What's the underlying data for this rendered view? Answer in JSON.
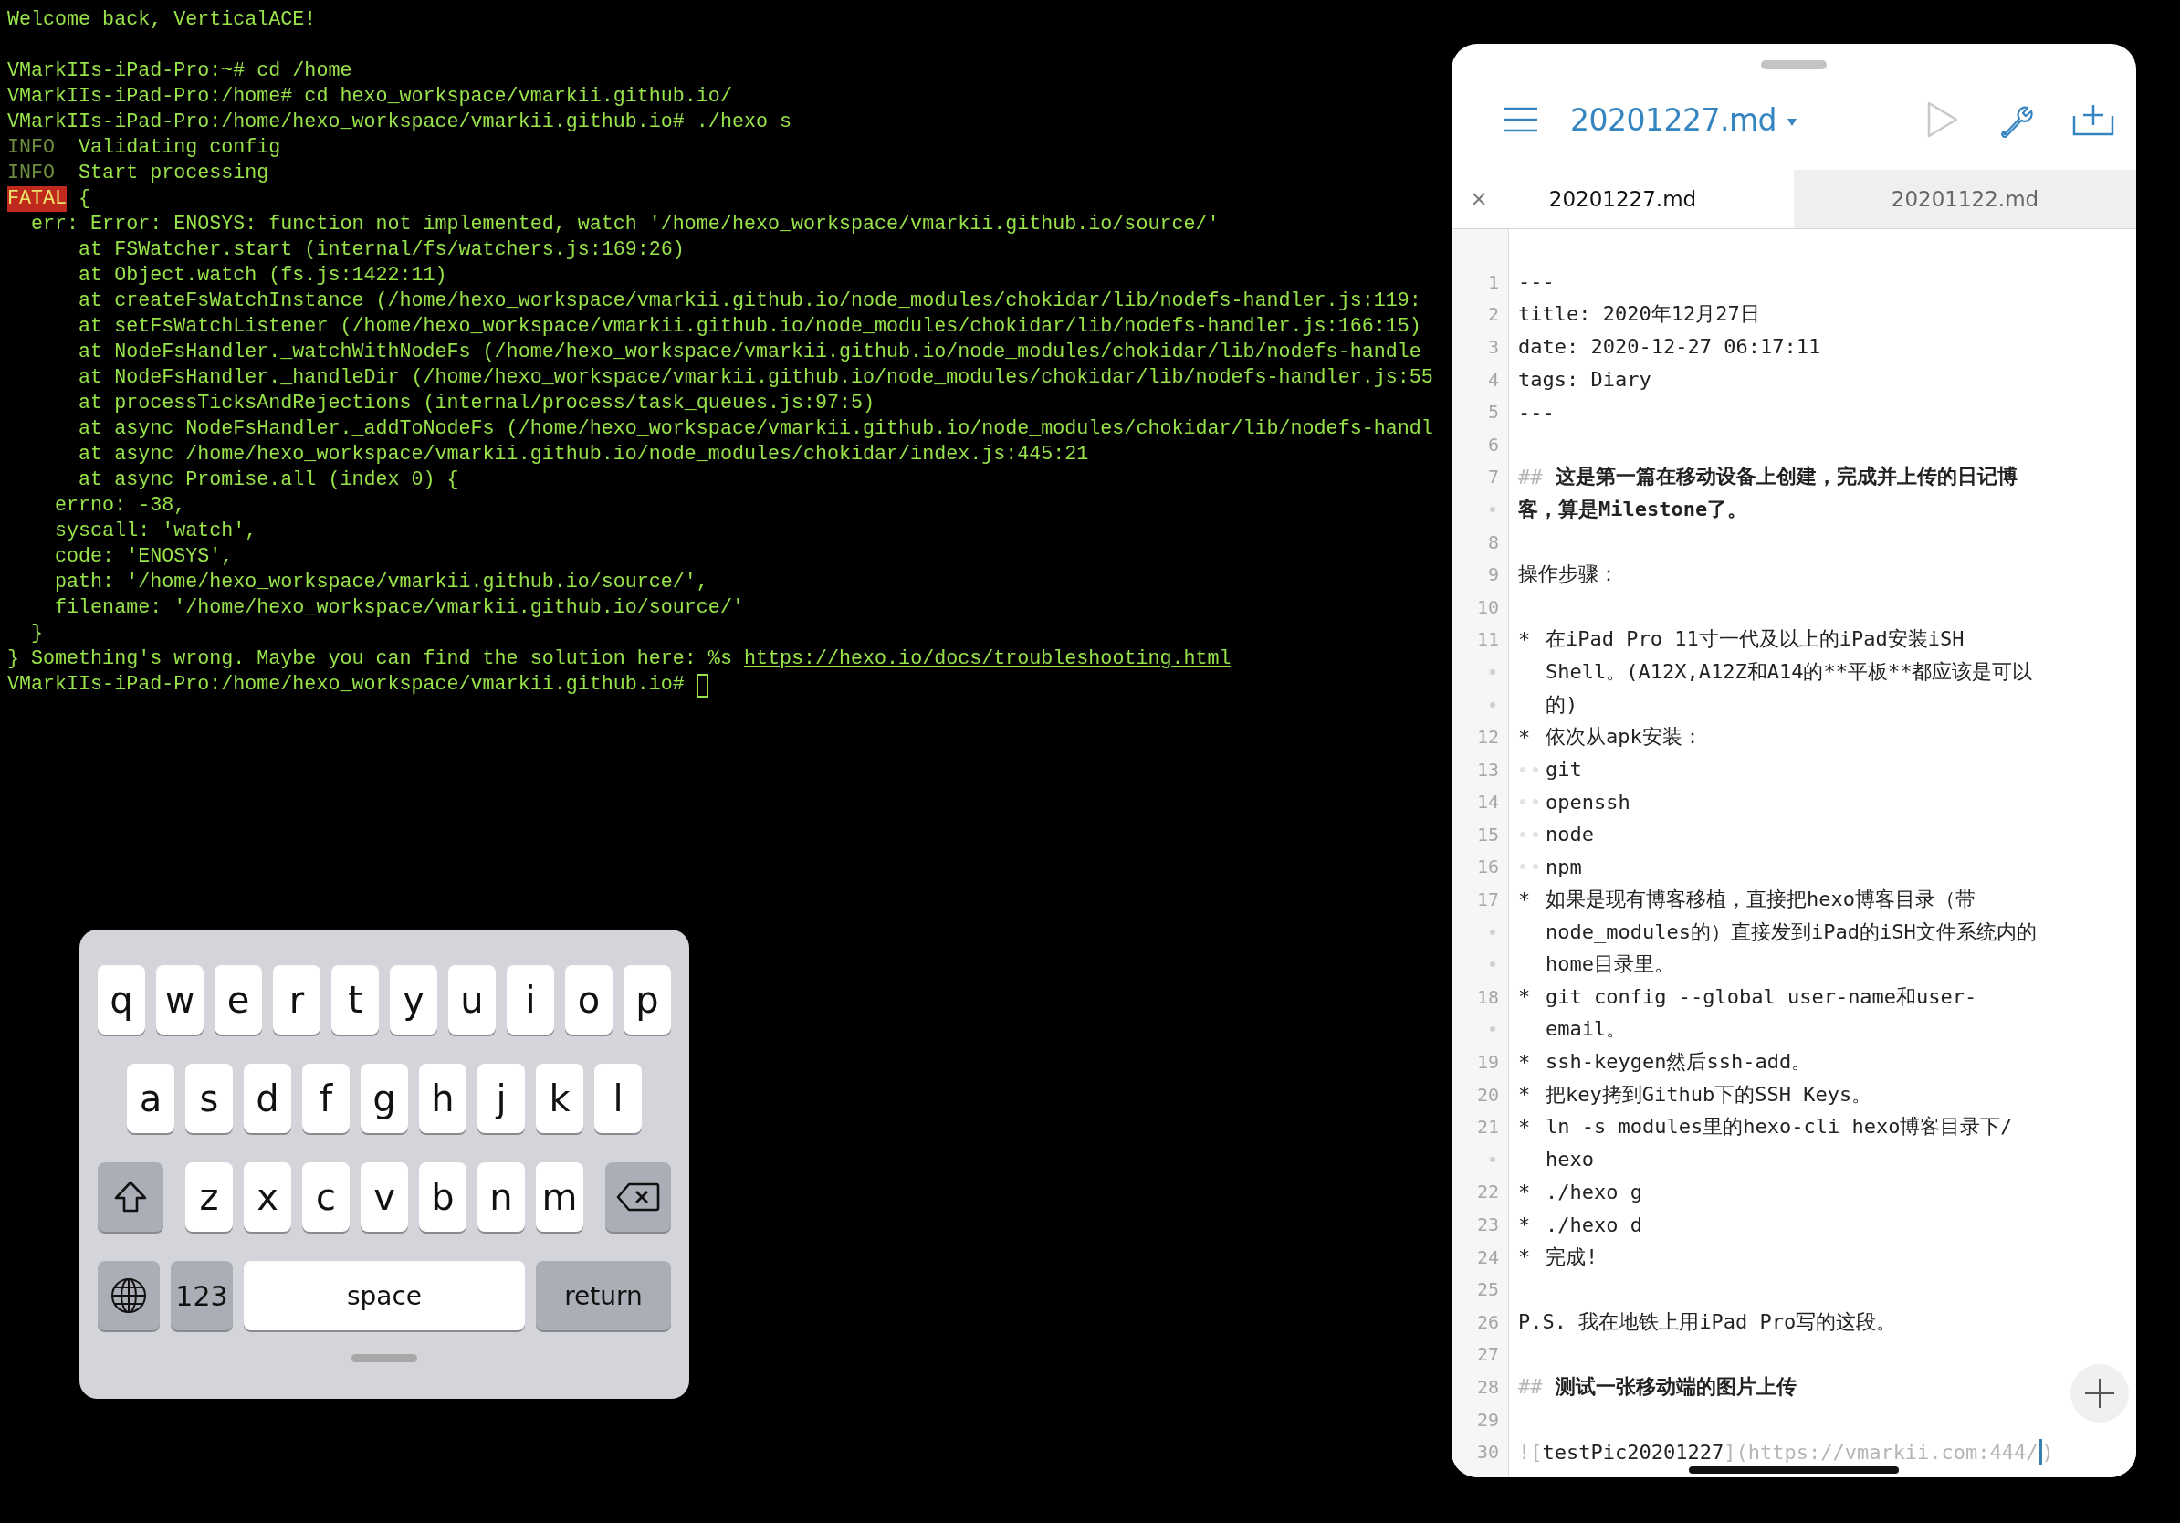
{
  "terminal": {
    "lines": [
      {
        "text": "Welcome back, VerticalACE!"
      },
      {
        "text": "VMarkIIs-iPad-Pro:~# cd /home",
        "blank_before": true
      },
      {
        "text": "VMarkIIs-iPad-Pro:/home# cd hexo_workspace/vmarkii.github.io/"
      },
      {
        "text": "VMarkIIs-iPad-Pro:/home/hexo_workspace/vmarkii.github.io# ./hexo s"
      },
      {
        "level": "INFO",
        "text": "  Validating config"
      },
      {
        "level": "INFO",
        "text": "  Start processing"
      },
      {
        "level": "FATAL",
        "text": " {"
      },
      {
        "text": "  err: Error: ENOSYS: function not implemented, watch '/home/hexo_workspace/vmarkii.github.io/source/'"
      },
      {
        "text": "      at FSWatcher.start (internal/fs/watchers.js:169:26)"
      },
      {
        "text": "      at Object.watch (fs.js:1422:11)"
      },
      {
        "text": "      at createFsWatchInstance (/home/hexo_workspace/vmarkii.github.io/node_modules/chokidar/lib/nodefs-handler.js:119:"
      },
      {
        "text": "      at setFsWatchListener (/home/hexo_workspace/vmarkii.github.io/node_modules/chokidar/lib/nodefs-handler.js:166:15)"
      },
      {
        "text": "      at NodeFsHandler._watchWithNodeFs (/home/hexo_workspace/vmarkii.github.io/node_modules/chokidar/lib/nodefs-handle"
      },
      {
        "text": "      at NodeFsHandler._handleDir (/home/hexo_workspace/vmarkii.github.io/node_modules/chokidar/lib/nodefs-handler.js:55"
      },
      {
        "text": "      at processTicksAndRejections (internal/process/task_queues.js:97:5)"
      },
      {
        "text": "      at async NodeFsHandler._addToNodeFs (/home/hexo_workspace/vmarkii.github.io/node_modules/chokidar/lib/nodefs-handl"
      },
      {
        "text": "      at async /home/hexo_workspace/vmarkii.github.io/node_modules/chokidar/index.js:445:21"
      },
      {
        "text": "      at async Promise.all (index 0) {"
      },
      {
        "text": "    errno: -38,"
      },
      {
        "text": "    syscall: 'watch',"
      },
      {
        "text": "    code: 'ENOSYS',"
      },
      {
        "text": "    path: '/home/hexo_workspace/vmarkii.github.io/source/',"
      },
      {
        "text": "    filename: '/home/hexo_workspace/vmarkii.github.io/source/'"
      },
      {
        "text": "  }"
      },
      {
        "text": "} Something's wrong. Maybe you can find the solution here: %s ",
        "link": "https://hexo.io/docs/troubleshooting.html"
      },
      {
        "text": "VMarkIIs-iPad-Pro:/home/hexo_workspace/vmarkii.github.io# ",
        "cursor": true
      }
    ]
  },
  "editor": {
    "title": "20201227.md",
    "tabs": [
      {
        "label": "20201227.md",
        "selected": true
      },
      {
        "label": "20201122.md",
        "selected": false
      }
    ],
    "lines": [
      {
        "number": "1",
        "kind": "plain",
        "rows": [
          "---"
        ]
      },
      {
        "number": "2",
        "kind": "plain",
        "rows": [
          "title: 2020年12月27日"
        ]
      },
      {
        "number": "3",
        "kind": "plain",
        "rows": [
          "date: 2020-12-27 06:17:11"
        ]
      },
      {
        "number": "4",
        "kind": "plain",
        "rows": [
          "tags: Diary"
        ]
      },
      {
        "number": "5",
        "kind": "plain",
        "rows": [
          "---"
        ]
      },
      {
        "number": "6",
        "kind": "blank"
      },
      {
        "number": "7",
        "kind": "heading",
        "marker": "##",
        "rows": [
          "这是第一篇在移动设备上创建，完成并上传的日记博",
          "客，算是Milestone了。"
        ]
      },
      {
        "number": "8",
        "kind": "blank"
      },
      {
        "number": "9",
        "kind": "plain",
        "rows": [
          "操作步骤："
        ]
      },
      {
        "number": "10",
        "kind": "blank"
      },
      {
        "number": "11",
        "kind": "bullet",
        "marker": "*",
        "rows": [
          "在iPad Pro 11寸一代及以上的iPad安装iSH",
          "Shell。(A12X,A12Z和A14的**平板**都应该是可以",
          "的)"
        ]
      },
      {
        "number": "12",
        "kind": "bullet",
        "marker": "*",
        "rows": [
          "依次从apk安装："
        ]
      },
      {
        "number": "13",
        "kind": "subitem",
        "rows": [
          "git"
        ]
      },
      {
        "number": "14",
        "kind": "subitem",
        "rows": [
          "openssh"
        ]
      },
      {
        "number": "15",
        "kind": "subitem",
        "rows": [
          "node"
        ]
      },
      {
        "number": "16",
        "kind": "subitem",
        "rows": [
          "npm"
        ]
      },
      {
        "number": "17",
        "kind": "bullet",
        "marker": "*",
        "rows": [
          "如果是现有博客移植，直接把hexo博客目录（带",
          "node_modules的）直接发到iPad的iSH文件系统内的",
          "home目录里。"
        ]
      },
      {
        "number": "18",
        "kind": "bullet",
        "marker": "*",
        "rows": [
          "git config --global user-name和user-",
          "email。"
        ]
      },
      {
        "number": "19",
        "kind": "bullet",
        "marker": "*",
        "rows": [
          "ssh-keygen然后ssh-add。"
        ]
      },
      {
        "number": "20",
        "kind": "bullet",
        "marker": "*",
        "rows": [
          "把key拷到Github下的SSH Keys。"
        ]
      },
      {
        "number": "21",
        "kind": "bullet",
        "marker": "*",
        "rows": [
          "ln -s modules里的hexo-cli hexo博客目录下/",
          "hexo"
        ]
      },
      {
        "number": "22",
        "kind": "bullet",
        "marker": "*",
        "rows": [
          "./hexo g"
        ]
      },
      {
        "number": "23",
        "kind": "bullet",
        "marker": "*",
        "rows": [
          "./hexo d"
        ]
      },
      {
        "number": "24",
        "kind": "bullet",
        "marker": "*",
        "rows": [
          "完成!"
        ]
      },
      {
        "number": "25",
        "kind": "blank"
      },
      {
        "number": "26",
        "kind": "plain",
        "rows": [
          "P.S. 我在地铁上用iPad Pro写的这段。"
        ]
      },
      {
        "number": "27",
        "kind": "blank"
      },
      {
        "number": "28",
        "kind": "heading",
        "marker": "##",
        "rows": [
          "测试一张移动端的图片上传"
        ]
      },
      {
        "number": "29",
        "kind": "blank"
      },
      {
        "number": "30",
        "kind": "image",
        "open": "![",
        "alt": "testPic20201227",
        "sep": "](",
        "url": "https://vmarkii.com:444/",
        "cursor": true,
        "close": ")"
      }
    ]
  },
  "keyboard": {
    "letter_rows": [
      [
        "q",
        "w",
        "e",
        "r",
        "t",
        "y",
        "u",
        "i",
        "o",
        "p"
      ],
      [
        "a",
        "s",
        "d",
        "f",
        "g",
        "h",
        "j",
        "k",
        "l"
      ],
      [
        "z",
        "x",
        "c",
        "v",
        "b",
        "n",
        "m"
      ]
    ],
    "numbers_key": "123",
    "space_key": "space",
    "return_key": "return"
  }
}
